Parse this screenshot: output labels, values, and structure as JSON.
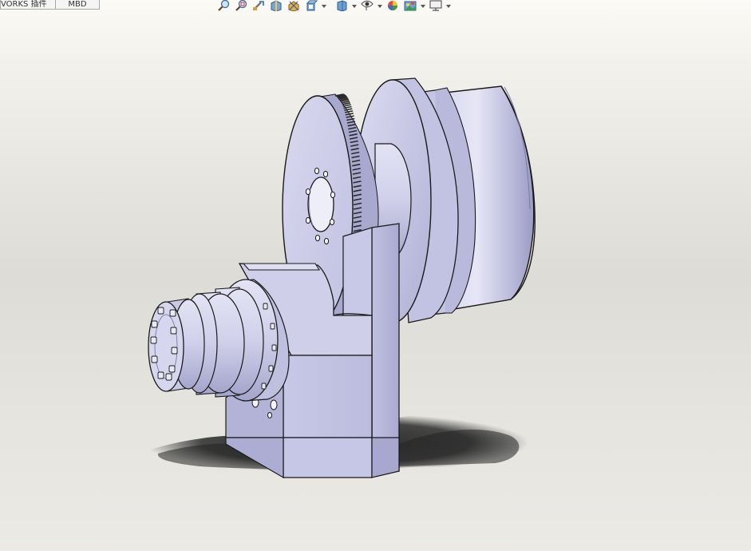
{
  "command_tabs": [
    {
      "label": "VORKS 插件"
    },
    {
      "label": "MBD"
    }
  ],
  "heads_up_toolbar": [
    {
      "icon": "zoom-to-fit-icon"
    },
    {
      "icon": "zoom-to-area-icon"
    },
    {
      "icon": "previous-view-icon"
    },
    {
      "icon": "section-view-icon"
    },
    {
      "icon": "dynamic-annotation-views-icon"
    },
    {
      "icon": "view-orientation-icon",
      "dropdown": true
    },
    {
      "icon": "display-style-icon",
      "dropdown": true
    },
    {
      "icon": "hide-show-items-icon",
      "dropdown": true
    },
    {
      "icon": "edit-appearance-icon"
    },
    {
      "icon": "apply-scene-icon",
      "dropdown": true
    },
    {
      "icon": "view-settings-icon",
      "dropdown": true
    }
  ],
  "colors": {
    "part_face": "#c9c9e6",
    "part_face_dark": "#9b9bc2",
    "part_face_light": "#e4e4f4",
    "edge": "#1a1a1a",
    "shadow": "#2b2b2b"
  }
}
